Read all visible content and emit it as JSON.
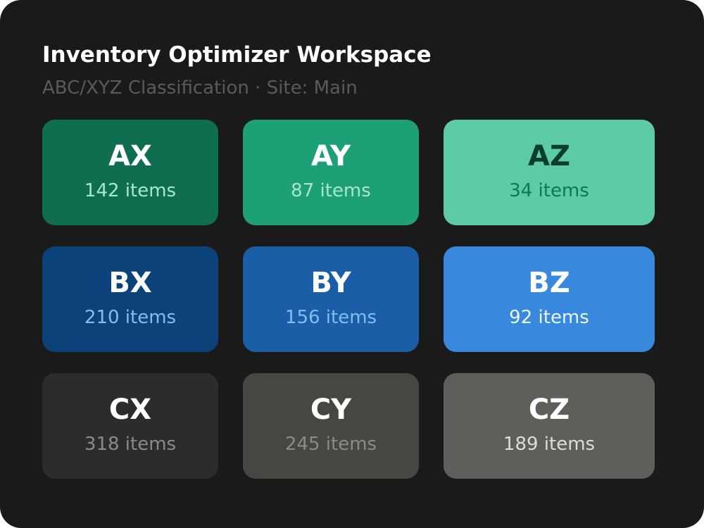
{
  "header": {
    "title": "Inventory Optimizer Workspace",
    "subtitle": "ABC/XYZ Classification · Site: Main"
  },
  "colors": {
    "panel_bg": "#1a1a1a",
    "subtitle": "#5a5a5a"
  },
  "cells": [
    {
      "code": "AX",
      "count_label": "142 items",
      "bg": "#0f6e50",
      "code_color": "#ffffff",
      "count_color": "#a8e6cc"
    },
    {
      "code": "AY",
      "count_label": "87 items",
      "bg": "#1ea076",
      "code_color": "#ffffff",
      "count_color": "#a8e6cc"
    },
    {
      "code": "AZ",
      "count_label": "34 items",
      "bg": "#5ccba6",
      "code_color": "#0a3d30",
      "count_color": "#117558"
    },
    {
      "code": "BX",
      "count_label": "210 items",
      "bg": "#0b4279",
      "code_color": "#ffffff",
      "count_color": "#82bdf2"
    },
    {
      "code": "BY",
      "count_label": "156 items",
      "bg": "#1a5ea8",
      "code_color": "#ffffff",
      "count_color": "#82bdf2"
    },
    {
      "code": "BZ",
      "count_label": "92 items",
      "bg": "#3888dd",
      "code_color": "#ffffff",
      "count_color": "#eef5fd"
    },
    {
      "code": "CX",
      "count_label": "318 items",
      "bg": "#2c2c2a",
      "code_color": "#ffffff",
      "count_color": "#8a8a86"
    },
    {
      "code": "CY",
      "count_label": "245 items",
      "bg": "#474742",
      "code_color": "#ffffff",
      "count_color": "#8a8a86"
    },
    {
      "code": "CZ",
      "count_label": "189 items",
      "bg": "#5f5e5a",
      "code_color": "#ffffff",
      "count_color": "#dcdcd8"
    }
  ]
}
